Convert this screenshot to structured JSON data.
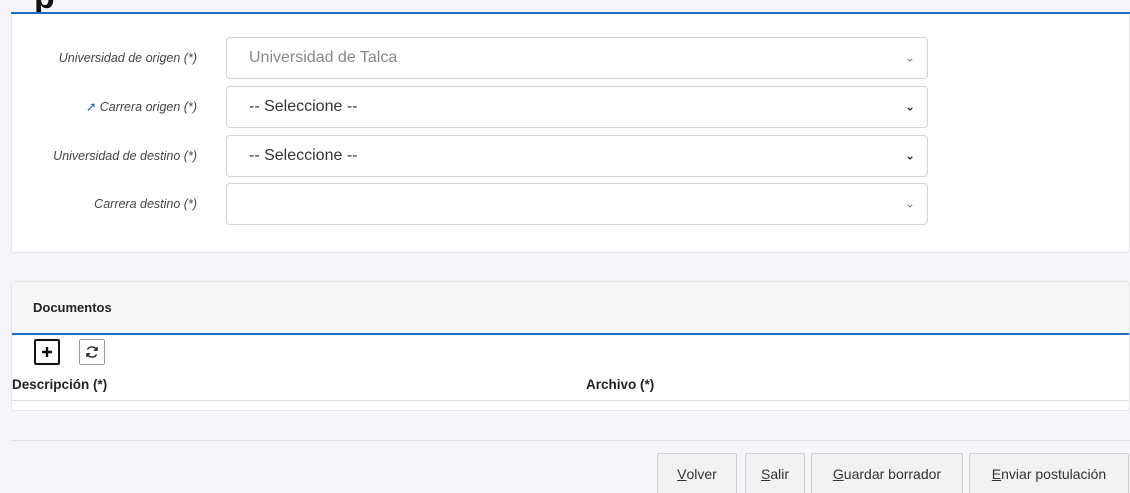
{
  "page": {
    "title_fragment": "p"
  },
  "form": {
    "fields": [
      {
        "label": "Universidad de origen (*)",
        "value": "Universidad de Talca",
        "state": "disabled",
        "pinned": false
      },
      {
        "label": "Carrera origen (*)",
        "value": "-- Seleccione --",
        "state": "active",
        "pinned": true
      },
      {
        "label": "Universidad de destino (*)",
        "value": "-- Seleccione --",
        "state": "active",
        "pinned": false
      },
      {
        "label": "Carrera destino (*)",
        "value": "",
        "state": "disabled",
        "pinned": false
      }
    ]
  },
  "documents": {
    "title": "Documentos",
    "columns": [
      "Descripción (*)",
      "Archivo (*)"
    ],
    "add_icon": "plus-icon",
    "refresh_icon": "refresh-icon"
  },
  "footer": {
    "buttons": [
      {
        "accel": "V",
        "rest": "olver"
      },
      {
        "accel": "S",
        "rest": "alir"
      },
      {
        "accel": "G",
        "rest": "uardar borrador"
      },
      {
        "accel": "E",
        "rest": "nviar postulación"
      }
    ]
  },
  "colors": {
    "accent": "#1c6fc8",
    "background": "#f4f6f9"
  }
}
